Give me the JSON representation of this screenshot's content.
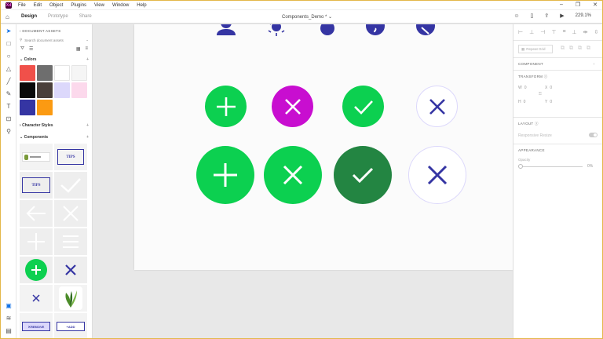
{
  "app": {
    "logo": "Xd",
    "doc_title": "Components_Demo *",
    "zoom": "229.1%"
  },
  "menu": [
    "File",
    "Edit",
    "Object",
    "Plugins",
    "View",
    "Window",
    "Help"
  ],
  "tabs": [
    {
      "label": "Design"
    },
    {
      "label": "Prototype"
    },
    {
      "label": "Share"
    }
  ],
  "assets": {
    "header": "DOCUMENT ASSETS",
    "search_placeholder": "Search document assets",
    "colors_label": "Colors",
    "char_styles_label": "Character Styles",
    "components_label": "Components",
    "colors": [
      "#f0504a",
      "#6e6e6e",
      "#ffffff",
      "#f5f5f5",
      "#0a0a0a",
      "#4a3f3a",
      "#dcd8fb",
      "#fcd9ec",
      "#3535a3",
      "#fb9a12"
    ],
    "tips_label": "TIPS",
    "remove_label": "REMOVE",
    "add_label": "ADD"
  },
  "canvas": {
    "colors": {
      "green": "#0cd050",
      "magenta": "#c80ed0",
      "dark_green": "#238542",
      "navy": "#3535a3",
      "light_ring": "#dcd8fb"
    }
  },
  "right_panel": {
    "repeat_grid": "Repeat Grid",
    "component_label": "COMPONENT",
    "transform_label": "TRANSFORM",
    "w_label": "W",
    "w_value": "0",
    "x_label": "X",
    "x_value": "0",
    "h_label": "H",
    "h_value": "0",
    "y_label": "Y",
    "y_value": "0",
    "layout_label": "LAYOUT",
    "responsive_label": "Responsive Resize",
    "appearance_label": "APPEARANCE",
    "opacity_label": "Opacity",
    "opacity_value": "0%"
  }
}
